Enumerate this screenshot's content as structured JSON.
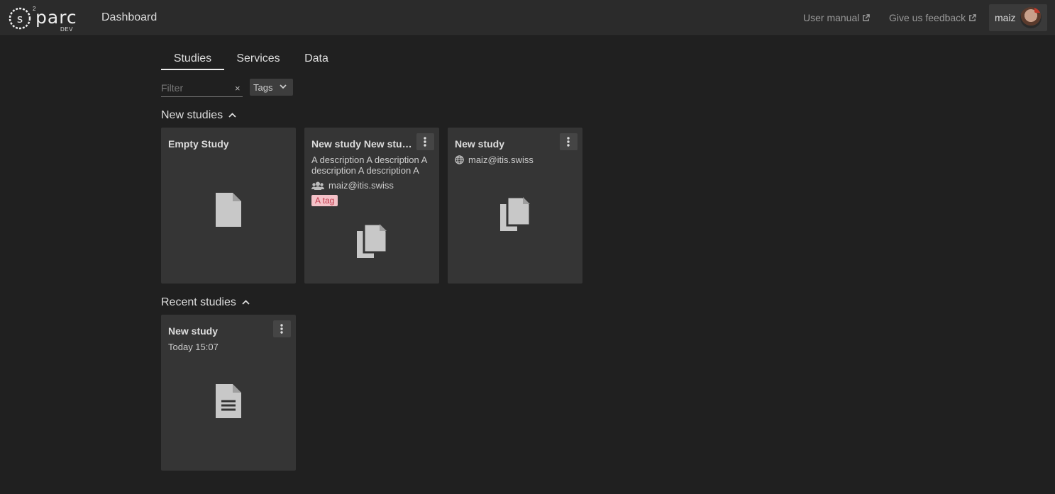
{
  "header": {
    "logo_text": "parc",
    "logo_superscript": "2",
    "logo_subtitle": "DEV",
    "title": "Dashboard",
    "user_manual": "User manual",
    "feedback": "Give us feedback",
    "user_name": "maiz"
  },
  "tabs": [
    "Studies",
    "Services",
    "Data"
  ],
  "filter": {
    "placeholder": "Filter",
    "clear": "×",
    "tags_label": "Tags"
  },
  "new_studies": {
    "title": "New studies",
    "cards": [
      {
        "title": "Empty Study",
        "icon": "file-icon"
      },
      {
        "title": "New study New study New study",
        "description": "A description A description A description A description A",
        "owner": "maiz@itis.swiss",
        "tag": "A tag",
        "icon": "copy-icon"
      },
      {
        "title": "New study",
        "owner": "maiz@itis.swiss",
        "icon": "copy-icon"
      }
    ]
  },
  "recent_studies": {
    "title": "Recent studies",
    "cards": [
      {
        "title": "New study",
        "date": "Today 15:07",
        "icon": "file-text-icon"
      }
    ]
  },
  "colors": {
    "background": "#202020",
    "card": "#353535",
    "tag_bg": "#f4c2c8",
    "tag_fg": "#c0394b"
  }
}
